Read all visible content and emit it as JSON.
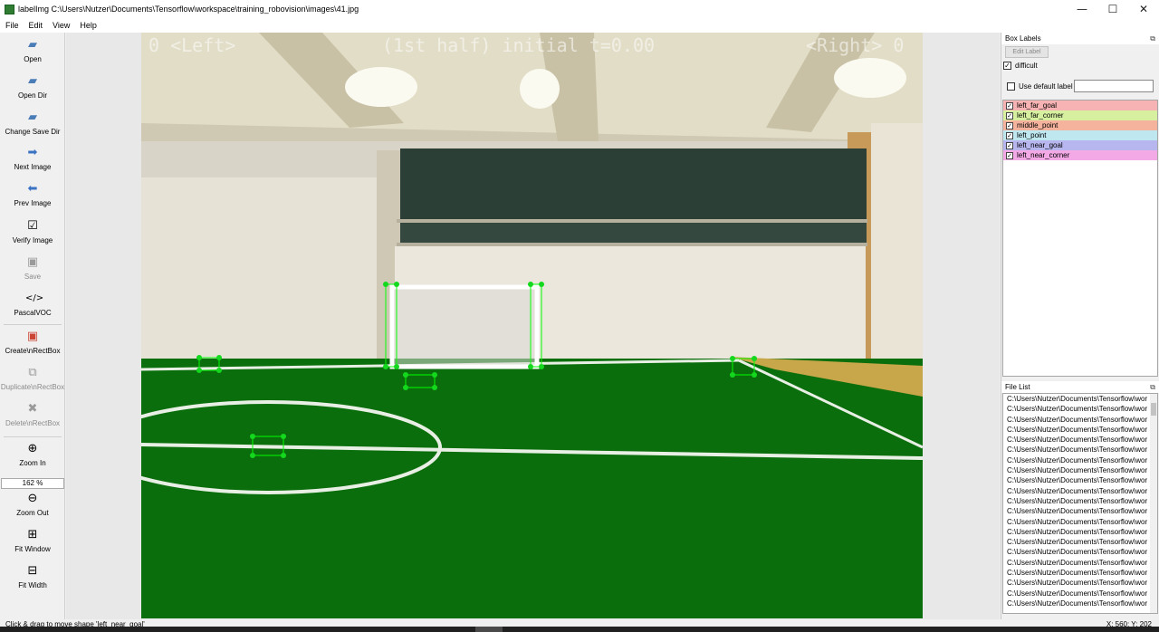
{
  "window": {
    "title": "labelImg C:\\Users\\Nutzer\\Documents\\Tensorflow\\workspace\\training_robovision\\images\\41.jpg",
    "controls": [
      "—",
      "☐",
      "✕"
    ]
  },
  "menu": [
    "File",
    "Edit",
    "View",
    "Help"
  ],
  "toolbar": {
    "open": "Open",
    "open_dir": "Open Dir",
    "change_save_dir": "Change Save Dir",
    "next_image": "Next Image",
    "prev_image": "Prev Image",
    "verify_image": "Verify Image",
    "save": "Save",
    "format": "PascalVOC",
    "create_rectbox": "Create\\nRectBox",
    "duplicate_rectbox": "Duplicate\\nRectBox",
    "delete_rectbox": "Delete\\nRectBox",
    "zoom_in": "Zoom In",
    "zoom_value": "162 %",
    "zoom_out": "Zoom Out",
    "fit_window": "Fit Window",
    "fit_width": "Fit Width"
  },
  "overlay": {
    "left": "0 <Left>",
    "center": "(1st half) initial t=0.00",
    "right": "<Right> 0"
  },
  "box_labels": {
    "title": "Box Labels",
    "edit_label": "Edit Label",
    "difficult": "difficult",
    "use_default_label": "Use default label",
    "default_label_value": "",
    "labels": [
      {
        "name": "left_far_goal",
        "color": "#f7b3b3",
        "checked": true
      },
      {
        "name": "left_far_corner",
        "color": "#d6f0a0",
        "checked": true
      },
      {
        "name": "middle_point",
        "color": "#f5b39e",
        "checked": true
      },
      {
        "name": "left_point",
        "color": "#bfe7f0",
        "checked": true
      },
      {
        "name": "left_near_goal",
        "color": "#b8b6ef",
        "checked": true
      },
      {
        "name": "left_near_corner",
        "color": "#f3a9e6",
        "checked": true
      }
    ]
  },
  "file_list": {
    "title": "File List",
    "items": [
      "C:\\Users\\Nutzer\\Documents\\Tensorflow\\wor",
      "C:\\Users\\Nutzer\\Documents\\Tensorflow\\wor",
      "C:\\Users\\Nutzer\\Documents\\Tensorflow\\wor",
      "C:\\Users\\Nutzer\\Documents\\Tensorflow\\wor",
      "C:\\Users\\Nutzer\\Documents\\Tensorflow\\wor",
      "C:\\Users\\Nutzer\\Documents\\Tensorflow\\wor",
      "C:\\Users\\Nutzer\\Documents\\Tensorflow\\wor",
      "C:\\Users\\Nutzer\\Documents\\Tensorflow\\wor",
      "C:\\Users\\Nutzer\\Documents\\Tensorflow\\wor",
      "C:\\Users\\Nutzer\\Documents\\Tensorflow\\wor",
      "C:\\Users\\Nutzer\\Documents\\Tensorflow\\wor",
      "C:\\Users\\Nutzer\\Documents\\Tensorflow\\wor",
      "C:\\Users\\Nutzer\\Documents\\Tensorflow\\wor",
      "C:\\Users\\Nutzer\\Documents\\Tensorflow\\wor",
      "C:\\Users\\Nutzer\\Documents\\Tensorflow\\wor",
      "C:\\Users\\Nutzer\\Documents\\Tensorflow\\wor",
      "C:\\Users\\Nutzer\\Documents\\Tensorflow\\wor",
      "C:\\Users\\Nutzer\\Documents\\Tensorflow\\wor",
      "C:\\Users\\Nutzer\\Documents\\Tensorflow\\wor",
      "C:\\Users\\Nutzer\\Documents\\Tensorflow\\wor",
      "C:\\Users\\Nutzer\\Documents\\Tensorflow\\wor"
    ]
  },
  "status": {
    "message": "Click & drag to move shape 'left_near_goal'",
    "coords": "X: 560; Y: 202"
  }
}
